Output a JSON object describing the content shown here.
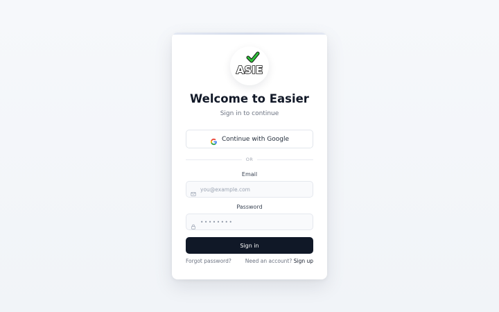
{
  "logo": {
    "text": "ASIE",
    "check_color": "#2fbf3a",
    "icon": "checkmark-icon"
  },
  "heading": {
    "title": "Welcome to Easier",
    "subtitle": "Sign in to continue"
  },
  "google": {
    "label": "Continue with Google",
    "icon": "google-icon"
  },
  "divider": {
    "text": "OR"
  },
  "email": {
    "label": "Email",
    "placeholder": "you@example.com",
    "value": "",
    "icon": "mail-icon"
  },
  "password": {
    "label": "Password",
    "placeholder": "••••••••",
    "value": "",
    "icon": "lock-icon"
  },
  "signin": {
    "label": "Sign in"
  },
  "footer": {
    "forgot": "Forgot password?",
    "need_account": "Need an account?",
    "signup": "Sign up"
  },
  "colors": {
    "primary_button": "#101827",
    "background": "#f3f5f8",
    "card": "#ffffff"
  }
}
